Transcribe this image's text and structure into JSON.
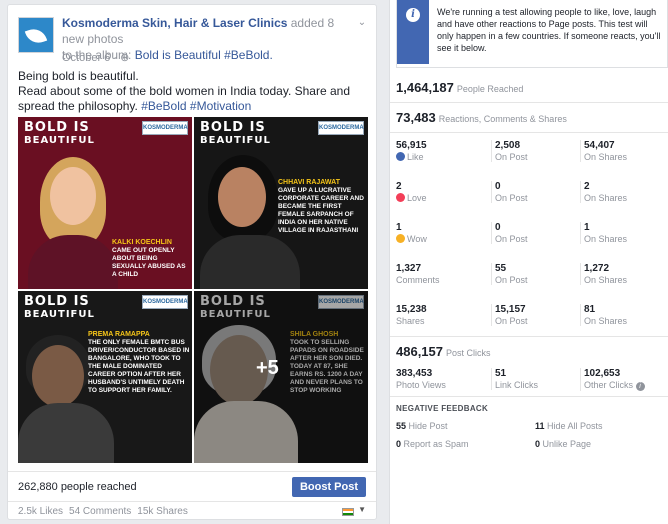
{
  "post": {
    "page_name": "Kosmoderma Skin, Hair & Laser Clinics",
    "action": " added 8 new photos",
    "to_album_prefix": "to the album: ",
    "album": "Bold is Beautiful #BeBold.",
    "date": "October 6 · ",
    "body_line1": "Being bold is beautiful.",
    "body_line2": "Read about some of the bold women in India today. Share and spread the philosophy. ",
    "body_hashtags": "#BeBold #Motivation",
    "photos": [
      {
        "bold": "BOLD ",
        "is": "IS",
        "beautiful": "BEAUTIFUL",
        "name": "KALKI KOECHLIN",
        "caption": "CAME OUT OPENLY ABOUT BEING SEXUALLY ABUSED AS A CHILD",
        "logo": "KOSMODERMA"
      },
      {
        "bold": "BOLD ",
        "is": "IS",
        "beautiful": "BEAUTIFUL",
        "name": "CHHAVI RAJAWAT",
        "caption": "GAVE UP A LUCRATIVE CORPORATE CAREER AND BECAME THE FIRST FEMALE SARPANCH OF INDIA ON HER NATIVE VILLAGE IN RAJASTHANI",
        "logo": "KOSMODERMA"
      },
      {
        "bold": "BOLD ",
        "is": "IS",
        "beautiful": "BEAUTIFUL",
        "name": "PREMA RAMAPPA",
        "caption": "THE ONLY FEMALE BMTC BUS DRIVER/CONDUCTOR BASED IN BANGALORE, WHO TOOK TO THE MALE DOMINATED CAREER OPTION AFTER HER HUSBAND'S UNTIMELY DEATH TO SUPPORT HER FAMILY.",
        "logo": "KOSMODERMA"
      },
      {
        "bold": "BOLD ",
        "is": "IS",
        "beautiful": "BEAUTIFUL",
        "name": "SHILA GHOSH",
        "caption": "TOOK TO SELLING PAPADS ON ROADSIDE AFTER HER SON DIED. TODAY AT 87, SHE EARNS RS. 1200 A DAY AND NEVER PLANS TO STOP WORKING",
        "logo": "KOSMODERMA"
      }
    ],
    "more_photos": "+5",
    "people_reached": "262,880 people reached",
    "boost_label": "Boost Post",
    "likes": "2.5k Likes",
    "comments": "54 Comments",
    "shares": "15k Shares"
  },
  "insights": {
    "notice": "We're running a test allowing people to like, love, laugh and have other reactions to Page posts. This test will only happen in a few countries. If someone reacts, you'll see it below.",
    "reached_value": "1,464,187",
    "reached_label": "People Reached",
    "engagement_value": "73,483",
    "engagement_label": "Reactions, Comments & Shares",
    "stats": [
      [
        {
          "v": "56,915",
          "l": "Like",
          "icon": "like-icon"
        },
        {
          "v": "2,508",
          "l": "On Post"
        },
        {
          "v": "54,407",
          "l": "On Shares"
        }
      ],
      [
        {
          "v": "2",
          "l": "Love",
          "icon": "love-icon"
        },
        {
          "v": "0",
          "l": "On Post"
        },
        {
          "v": "2",
          "l": "On Shares"
        }
      ],
      [
        {
          "v": "1",
          "l": "Wow",
          "icon": "wow-icon"
        },
        {
          "v": "0",
          "l": "On Post"
        },
        {
          "v": "1",
          "l": "On Shares"
        }
      ],
      [
        {
          "v": "1,327",
          "l": "Comments"
        },
        {
          "v": "55",
          "l": "On Post"
        },
        {
          "v": "1,272",
          "l": "On Shares"
        }
      ],
      [
        {
          "v": "15,238",
          "l": "Shares"
        },
        {
          "v": "15,157",
          "l": "On Post"
        },
        {
          "v": "81",
          "l": "On Shares"
        }
      ]
    ],
    "clicks_value": "486,157",
    "clicks_label": "Post Clicks",
    "clicks": [
      {
        "v": "383,453",
        "l": "Photo Views"
      },
      {
        "v": "51",
        "l": "Link Clicks"
      },
      {
        "v": "102,653",
        "l": "Other Clicks"
      }
    ],
    "negative_title": "NEGATIVE FEEDBACK",
    "negative": [
      {
        "v": "55",
        "l": " Hide Post"
      },
      {
        "v": "11",
        "l": " Hide All Posts"
      },
      {
        "v": "0",
        "l": " Report as Spam"
      },
      {
        "v": "0",
        "l": " Unlike Page"
      }
    ]
  }
}
